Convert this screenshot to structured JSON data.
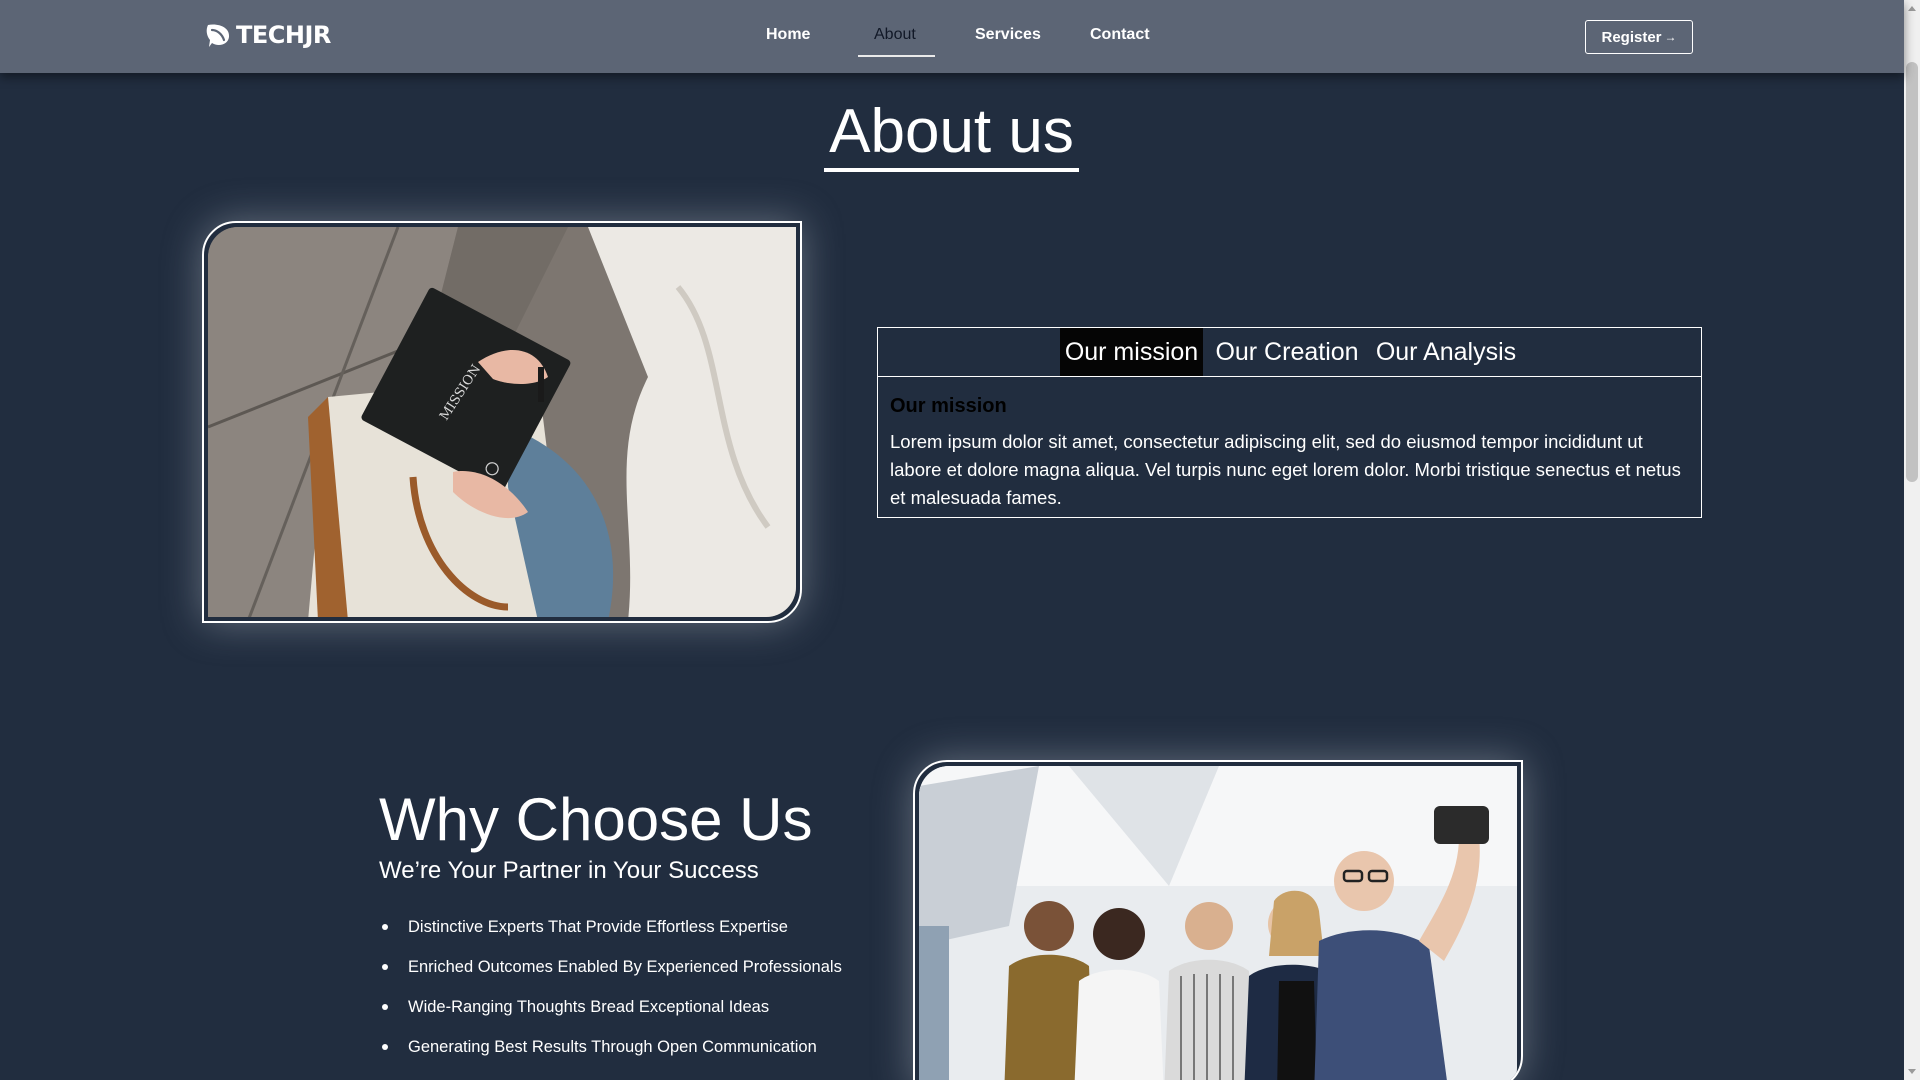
{
  "navbar": {
    "brand": "TECHJR",
    "links": [
      {
        "label": "Home"
      },
      {
        "label": "About"
      },
      {
        "label": "Services"
      },
      {
        "label": "Contact"
      }
    ],
    "register_label": "Register"
  },
  "about": {
    "title": "About us",
    "tabs": [
      {
        "label": "Our mission"
      },
      {
        "label": "Our Creation"
      },
      {
        "label": "Our Analysis"
      }
    ],
    "active_tab_heading": "Our mission",
    "active_tab_text": "Lorem ipsum dolor sit amet, consectetur adipiscing elit, sed do eiusmod tempor incididunt ut labore et dolore magna aliqua. Vel turpis nunc eget lorem dolor. Morbi tristique senectus et netus et malesuada fames.",
    "photo_book_text": "MISSION"
  },
  "why": {
    "title": "Why Choose Us",
    "subtitle": "We’re Your Partner in Your Success",
    "items": [
      "Distinctive Experts That Provide Effortless Expertise",
      "Enriched Outcomes Enabled By Experienced Professionals",
      "Wide-Ranging Thoughts Bread Exceptional Ideas",
      "Generating Best Results Through Open Communication"
    ]
  },
  "colors": {
    "page_background": "#212d3f",
    "navbar_background": "#5c6575",
    "active_tab": "#050505"
  },
  "icons": {
    "brand_logo": "leaf-chat-logo-icon",
    "register_arrow": "arrow-right-icon"
  }
}
